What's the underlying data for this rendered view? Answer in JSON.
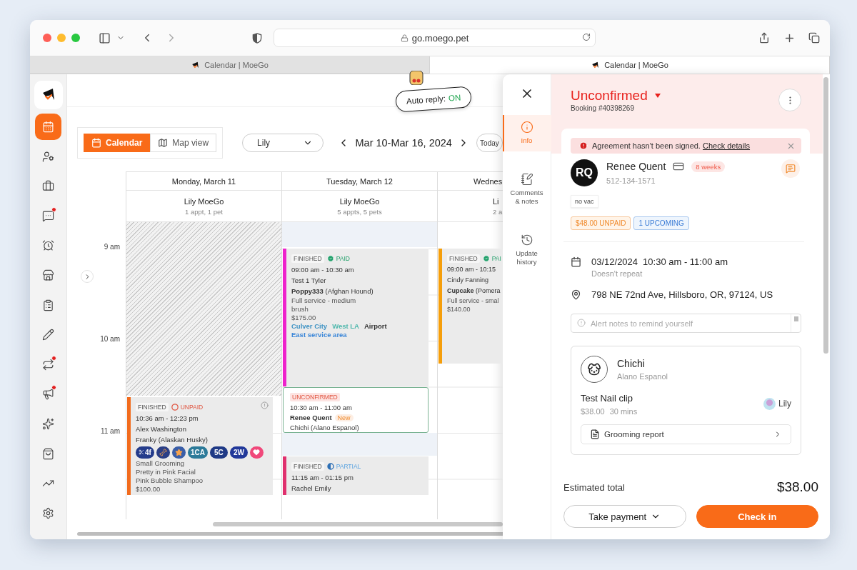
{
  "browser": {
    "url": "go.moego.pet",
    "tabs": [
      {
        "title": "Calendar | MoeGo",
        "selected": false
      },
      {
        "title": "Calendar | MoeGo",
        "selected": true
      }
    ]
  },
  "sidebar": {
    "items": [
      {
        "selected": true,
        "alert": false
      },
      {
        "selected": false,
        "alert": false
      },
      {
        "selected": false,
        "alert": false
      },
      {
        "selected": false,
        "alert": true
      },
      {
        "selected": false,
        "alert": false
      },
      {
        "selected": false,
        "alert": false
      },
      {
        "selected": false,
        "alert": false
      },
      {
        "selected": false,
        "alert": false
      },
      {
        "selected": false,
        "alert": true
      },
      {
        "selected": false,
        "alert": true
      },
      {
        "selected": false,
        "alert": false
      },
      {
        "selected": false,
        "alert": false
      },
      {
        "selected": false,
        "alert": false
      },
      {
        "selected": false,
        "alert": false
      }
    ]
  },
  "header": {
    "auto_reply": {
      "label": "Auto reply:",
      "status": "ON",
      "on": true
    }
  },
  "calendar": {
    "views": [
      {
        "label": "Calendar",
        "selected": true
      },
      {
        "label": "Map view",
        "selected": false
      }
    ],
    "staff_select": "Lily",
    "range": "Mar 10-Mar 16, 2024",
    "today": "Today",
    "time_labels": [
      "9 am",
      "10 am",
      "11 am"
    ],
    "days": [
      {
        "title": "Monday, March 11",
        "staff": "Lily MoeGo",
        "summary": "1 appt, 1 pet",
        "blocks": [
          {
            "kind": "blocked"
          }
        ],
        "appointments": [
          {
            "kind": "finished",
            "color": "#f26b1d",
            "status": "FINISHED",
            "payment": {
              "kind": "unpaid",
              "label": "UNPAID"
            },
            "alert_icon": true,
            "time": "10:36 am - 12:23 pm",
            "client": "Alex Washington",
            "pet": "Franky (Alaskan Husky)",
            "badges": [
              {
                "kind": "tag",
                "label": "4f",
                "color": "#243c8c"
              },
              {
                "kind": "image",
                "color": "#2b3f86"
              },
              {
                "kind": "image",
                "color": "#3a5ea8"
              },
              {
                "kind": "tag",
                "label": "1CA",
                "color": "#2c7a99"
              },
              {
                "kind": "tag",
                "label": "5C",
                "color": "#1f3a86"
              },
              {
                "kind": "tag",
                "label": "2W",
                "color": "#22399a"
              },
              {
                "kind": "image",
                "color": "#f0487a"
              }
            ],
            "services": [
              "Small Grooming",
              "Pretty in Pink Facial",
              "Pink Bubble Shampoo"
            ],
            "price": "$100.00"
          }
        ]
      },
      {
        "title": "Tuesday, March 12",
        "staff": "Lily MoeGo",
        "summary": "5 appts, 5 pets",
        "blocks": [
          {
            "kind": "unavailable"
          },
          {
            "kind": "unavailable"
          }
        ],
        "appointments": [
          {
            "kind": "finished",
            "color": "#ee22cc",
            "status": "FINISHED",
            "payment": {
              "kind": "paid",
              "label": "PAID"
            },
            "alert_icon": false,
            "time": "09:00 am - 10:30 am",
            "client": "Test 1 Tyler",
            "pet": "**Poppy333** (Afghan Hound)",
            "services": [
              "Full service - medium",
              "brush"
            ],
            "price": "$175.00",
            "areas": [
              {
                "label": "Culver City",
                "color": "#3f93c4"
              },
              {
                "label": "West LA",
                "color": "#4fb8ad"
              },
              {
                "label": "Airport",
                "color": "#333333"
              },
              {
                "label": "East service area",
                "color": "#3a86d8"
              }
            ]
          },
          {
            "kind": "unconfirmed",
            "color": "#7ab393",
            "status": "UNCONFIRMED",
            "time": "10:30 am - 11:00 am",
            "client": "Renee Quent",
            "client_tag": "New",
            "pet": "Chichi (Alano Espanol)"
          },
          {
            "kind": "finished",
            "color": "#e0306e",
            "status": "FINISHED",
            "payment": {
              "kind": "partial",
              "label": "PARTIAL"
            },
            "alert_icon": false,
            "time": "11:15 am - 01:15 pm",
            "client": "Rachel Emily"
          }
        ]
      },
      {
        "title": "Wednes",
        "staff": "Li",
        "summary": "2 a",
        "appointments": [
          {
            "kind": "finished",
            "color": "#f59e0b",
            "status": "FINISHED",
            "payment": {
              "kind": "paid",
              "label": "PAI"
            },
            "alert_icon": false,
            "time": "09:00 am - 10:15",
            "client": "Cindy Fanning",
            "pet": "**Cupcake** (Pomera",
            "services": [
              "Full service - smal"
            ],
            "price": "$140.00"
          }
        ]
      }
    ]
  },
  "drawer": {
    "nav": [
      {
        "label": "Info",
        "selected": true
      },
      {
        "label": "Comments & notes",
        "selected": false
      },
      {
        "label": "Update history",
        "selected": false
      }
    ],
    "status": "Unconfirmed",
    "booking": "Booking #40398269",
    "alert": {
      "text": "Agreement hasn't been signed.",
      "link": "Check details"
    },
    "client": {
      "initials": "RQ",
      "name": "Renee Quent",
      "frequency": "8 weeks",
      "phone": "512-134-1571",
      "tags": [
        "no vac"
      ]
    },
    "badges": [
      {
        "kind": "unpaid",
        "label": "$48.00 UNPAID"
      },
      {
        "kind": "upcoming",
        "label": "1 UPCOMING"
      }
    ],
    "schedule": {
      "date": "03/12/2024",
      "time": "10:30 am - 11:00 am",
      "repeat": "Doesn't repeat"
    },
    "address": "798 NE 72nd Ave, Hillsboro, OR, 97124, US",
    "alert_notes": {
      "placeholder": "Alert notes to remind yourself"
    },
    "pets": [
      {
        "name": "Chichi",
        "breed": "Alano Espanol",
        "services": [
          {
            "name": "Test Nail clip",
            "price": "$38.00",
            "duration": "30 mins",
            "staff": "Lily"
          }
        ],
        "report": "Grooming report"
      }
    ],
    "total": {
      "label": "Estimated total",
      "amount": "$38.00"
    },
    "actions": [
      {
        "kind": "secondary",
        "label": "Take payment"
      },
      {
        "kind": "primary",
        "label": "Check in"
      }
    ]
  }
}
